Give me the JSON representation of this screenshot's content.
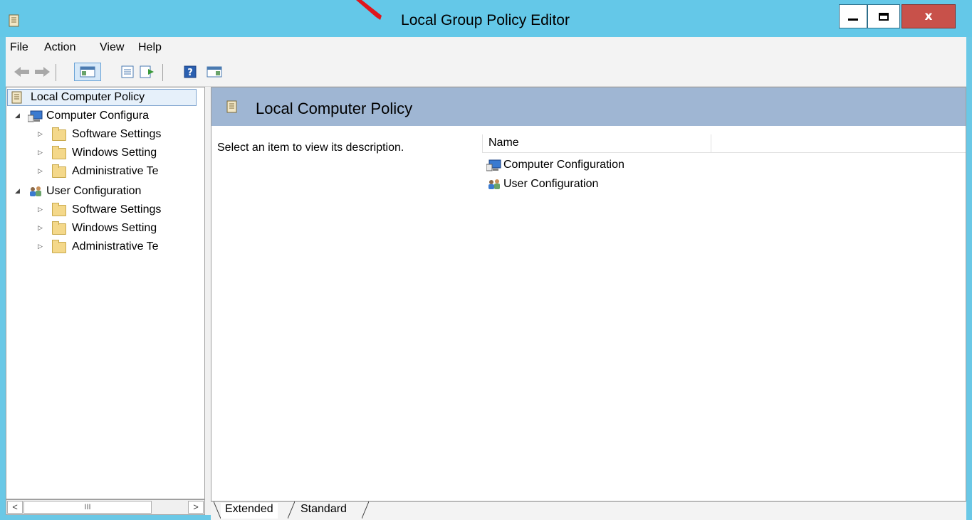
{
  "window": {
    "title": "Local Group Policy Editor",
    "accent_color": "#64c8e8",
    "close_color": "#c8514a",
    "controls": {
      "minimize_icon": "minimize-icon",
      "maximize_icon": "maximize-icon",
      "close_glyph": "x"
    }
  },
  "menu": {
    "items": [
      "File",
      "Action",
      "View",
      "Help"
    ]
  },
  "toolbar": {
    "buttons": [
      "back-arrow-icon",
      "forward-arrow-icon",
      "show-hide-tree-icon",
      "properties-icon",
      "export-list-icon",
      "help-icon",
      "show-action-pane-icon"
    ]
  },
  "tree": {
    "root": "Local Computer Policy",
    "computer_config": {
      "label": "Computer Configura",
      "children": [
        "Software Settings",
        "Windows Setting",
        "Administrative Te"
      ]
    },
    "user_config": {
      "label": "User Configuration",
      "children": [
        "Software Settings",
        "Windows Setting",
        "Administrative Te"
      ]
    },
    "scrollbar": {
      "left": "<",
      "thumb": "III",
      "right": ">"
    }
  },
  "details": {
    "header_title": "Local Computer Policy",
    "description": "Select an item to view its description.",
    "column_name": "Name",
    "items": [
      "Computer Configuration",
      "User Configuration"
    ]
  },
  "tabs": {
    "extended": "Extended",
    "standard": "Standard"
  }
}
